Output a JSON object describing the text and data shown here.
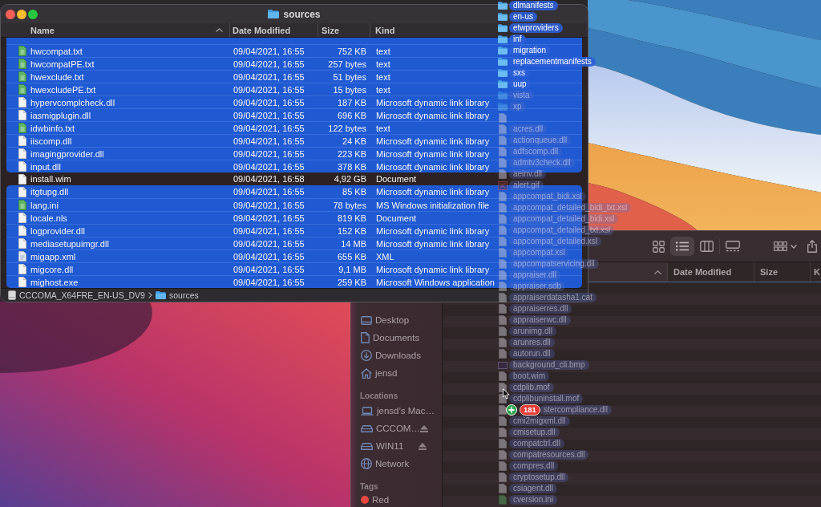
{
  "front_window": {
    "title": "sources",
    "columns": [
      {
        "label": "Name",
        "sorted": true
      },
      {
        "label": "Date Modified",
        "sorted": false
      },
      {
        "label": "Size",
        "sorted": false
      },
      {
        "label": "Kind",
        "sorted": false
      }
    ],
    "rows": [
      {
        "selected": true
      },
      {
        "name": "hwcompat.txt",
        "date_modified": "09/04/2021, 16:55",
        "size": "752 KB",
        "file_kind": "text",
        "kind": "text",
        "selected": true
      },
      {
        "name": "hwcompatPE.txt",
        "date_modified": "09/04/2021, 16:55",
        "size": "257 bytes",
        "file_kind": "text",
        "kind": "text",
        "selected": true
      },
      {
        "name": "hwexclude.txt",
        "date_modified": "09/04/2021, 16:55",
        "size": "51 bytes",
        "file_kind": "text",
        "kind": "text",
        "selected": true
      },
      {
        "name": "hwexcludePE.txt",
        "date_modified": "09/04/2021, 16:55",
        "size": "15 bytes",
        "file_kind": "text",
        "kind": "text",
        "selected": true
      },
      {
        "name": "hypervcomplcheck.dll",
        "date_modified": "09/04/2021, 16:55",
        "size": "187 KB",
        "file_kind": "Microsoft dynamic link library",
        "kind": "document",
        "selected": true
      },
      {
        "name": "iasmigplugin.dll",
        "date_modified": "09/04/2021, 16:55",
        "size": "696 KB",
        "file_kind": "Microsoft dynamic link library",
        "kind": "document",
        "selected": true
      },
      {
        "name": "idwbinfo.txt",
        "date_modified": "09/04/2021, 16:55",
        "size": "122 bytes",
        "file_kind": "text",
        "kind": "text",
        "selected": true
      },
      {
        "name": "iiscomp.dll",
        "date_modified": "09/04/2021, 16:55",
        "size": "24 KB",
        "file_kind": "Microsoft dynamic link library",
        "kind": "document",
        "selected": true
      },
      {
        "name": "imagingprovider.dll",
        "date_modified": "09/04/2021, 16:55",
        "size": "223 KB",
        "file_kind": "Microsoft dynamic link library",
        "kind": "document",
        "selected": true
      },
      {
        "name": "input.dll",
        "date_modified": "09/04/2021, 16:55",
        "size": "378 KB",
        "file_kind": "Microsoft dynamic link library",
        "kind": "document",
        "selected": true
      },
      {
        "name": "install.wim",
        "date_modified": "09/04/2021, 16:58",
        "size": "4,92 GB",
        "file_kind": "Document",
        "kind": "document",
        "selected": false
      },
      {
        "name": "itgtupg.dll",
        "date_modified": "09/04/2021, 16:55",
        "size": "85 KB",
        "file_kind": "Microsoft dynamic link library",
        "kind": "document",
        "selected": true
      },
      {
        "name": "lang.ini",
        "date_modified": "09/04/2021, 16:55",
        "size": "78 bytes",
        "file_kind": "MS Windows initialization file",
        "kind": "text",
        "selected": true
      },
      {
        "name": "locale.nls",
        "date_modified": "09/04/2021, 16:55",
        "size": "819 KB",
        "file_kind": "Document",
        "kind": "document",
        "selected": true
      },
      {
        "name": "logprovider.dll",
        "date_modified": "09/04/2021, 16:55",
        "size": "152 KB",
        "file_kind": "Microsoft dynamic link library",
        "kind": "document",
        "selected": true
      },
      {
        "name": "mediasetupuimgr.dll",
        "date_modified": "09/04/2021, 16:55",
        "size": "14 MB",
        "file_kind": "Microsoft dynamic link library",
        "kind": "document",
        "selected": true
      },
      {
        "name": "migapp.xml",
        "date_modified": "09/04/2021, 16:55",
        "size": "655 KB",
        "file_kind": "XML",
        "kind": "markup",
        "selected": true
      },
      {
        "name": "migcore.dll",
        "date_modified": "09/04/2021, 16:55",
        "size": "9,1 MB",
        "file_kind": "Microsoft dynamic link library",
        "kind": "document",
        "selected": true
      },
      {
        "name": "mighost.exe",
        "date_modified": "09/04/2021, 16:55",
        "size": "259 KB",
        "file_kind": "Microsoft Windows application",
        "kind": "document",
        "selected": true
      }
    ],
    "path": [
      {
        "label": "CCCOMA_X64FRE_EN-US_DV9",
        "kind": "drive"
      },
      {
        "label": "sources",
        "kind": "folder"
      }
    ]
  },
  "drag": {
    "items": [
      {
        "name": "dlmanifests",
        "kind": "folder",
        "faded": false
      },
      {
        "name": "en-us",
        "kind": "folder",
        "faded": false
      },
      {
        "name": "etwproviders",
        "kind": "folder",
        "faded": false
      },
      {
        "name": "inf",
        "kind": "folder",
        "faded": false
      },
      {
        "name": "migration",
        "kind": "folder",
        "faded": false
      },
      {
        "name": "replacementmanifests",
        "kind": "folder",
        "faded": false
      },
      {
        "name": "sxs",
        "kind": "folder",
        "faded": false
      },
      {
        "name": "uup",
        "kind": "folder",
        "faded": false
      },
      {
        "name": "vista",
        "kind": "folder",
        "faded": true
      },
      {
        "name": "xp",
        "kind": "folder",
        "faded": true
      },
      {
        "kind": "document",
        "faded": true
      },
      {
        "name": "acres.dll",
        "kind": "document",
        "faded": true
      },
      {
        "name": "actionqueue.dll",
        "kind": "document",
        "faded": true
      },
      {
        "name": "adfscomp.dll",
        "kind": "document",
        "faded": true
      },
      {
        "name": "admtv3check.dll",
        "kind": "document",
        "faded": true
      },
      {
        "name": "aeinv.dll",
        "kind": "document",
        "faded": true
      },
      {
        "name": "alert.gif",
        "kind": "broken",
        "faded": true
      },
      {
        "name": "appcompat_bidi.xsl",
        "kind": "document",
        "faded": true
      },
      {
        "name": "appcompat_detailed_bidi_txt.xsl",
        "kind": "document",
        "faded": true
      },
      {
        "name": "appcompat_detailed_bidi.xsl",
        "kind": "document",
        "faded": true
      },
      {
        "name": "appcompat_detailed_txt.xsl",
        "kind": "document",
        "faded": true
      },
      {
        "name": "appcompat_detailed.xsl",
        "kind": "document",
        "faded": true
      },
      {
        "name": "appcompat.xsl",
        "kind": "document",
        "faded": true
      },
      {
        "name": "appcompatservicing.dll",
        "kind": "document",
        "faded": true
      },
      {
        "name": "appraiser.dll",
        "kind": "document",
        "faded": true
      },
      {
        "name": "appraiser.sdb",
        "kind": "document",
        "faded": true
      },
      {
        "name": "appraiserdatasha1.cat",
        "kind": "document",
        "faded": true
      },
      {
        "name": "appraiserres.dll",
        "kind": "document",
        "faded": true
      },
      {
        "name": "appraiserwc.dll",
        "kind": "document",
        "faded": true
      },
      {
        "name": "arunimg.dll",
        "kind": "document",
        "faded": true
      },
      {
        "name": "arunres.dll",
        "kind": "document",
        "faded": true
      },
      {
        "name": "autorun.dll",
        "kind": "document",
        "faded": true
      },
      {
        "name": "background_cli.bmp",
        "kind": "image",
        "faded": true
      },
      {
        "name": "boot.wim",
        "kind": "document",
        "faded": true
      },
      {
        "name": "cdplib.mof",
        "kind": "document",
        "faded": true
      },
      {
        "name": "cdplibuninstall.mof",
        "kind": "document",
        "faded": true
      },
      {
        "name": "stercompliance.dll",
        "kind": "document",
        "faded": true
      },
      {
        "name": "cmi2migxml.dll",
        "kind": "document",
        "faded": true
      },
      {
        "name": "cmisetup.dll",
        "kind": "document",
        "faded": true
      },
      {
        "name": "compatctrl.dll",
        "kind": "document",
        "faded": true
      },
      {
        "name": "compatresources.dll",
        "kind": "document",
        "faded": true
      },
      {
        "name": "compres.dll",
        "kind": "document",
        "faded": true
      },
      {
        "name": "cryptosetup.dll",
        "kind": "document",
        "faded": true
      },
      {
        "name": "csiagent.dll",
        "kind": "document",
        "faded": true
      },
      {
        "name": "cversion.ini",
        "kind": "text",
        "faded": true
      }
    ],
    "count": "181"
  },
  "back_window": {
    "toolbar": {
      "view_modes": [
        {
          "kind": "icons",
          "selected": false
        },
        {
          "kind": "list",
          "selected": true
        },
        {
          "kind": "columns",
          "selected": false
        },
        {
          "kind": "gallery",
          "selected": false
        }
      ]
    },
    "columns": [
      {
        "sorted": true
      },
      {
        "label": "Date Modified",
        "sorted": false
      },
      {
        "label": "Size",
        "sorted": false
      },
      {
        "label": "K",
        "sorted": false
      }
    ],
    "sidebar": {
      "sections": [
        {
          "items": [
            {
              "label": "Desktop",
              "kind": "desktop",
              "ejectable": false
            },
            {
              "label": "Documents",
              "kind": "documents",
              "ejectable": false
            },
            {
              "label": "Downloads",
              "kind": "downloads",
              "ejectable": false
            },
            {
              "label": "jensd",
              "kind": "home",
              "ejectable": false
            }
          ]
        },
        {
          "heading": "Locations",
          "items": [
            {
              "label": "jensd’s Mac…",
              "kind": "computer",
              "ejectable": false
            },
            {
              "label": "CCCOM…",
              "kind": "drive",
              "ejectable": true
            },
            {
              "label": "WIN11",
              "kind": "drive",
              "ejectable": true
            },
            {
              "label": "Network",
              "kind": "network",
              "ejectable": false
            }
          ]
        },
        {
          "heading": "Tags",
          "items": [
            {
              "label": "Red",
              "kind": "tag",
              "color": "#e5483f",
              "ejectable": false
            }
          ]
        }
      ]
    }
  }
}
